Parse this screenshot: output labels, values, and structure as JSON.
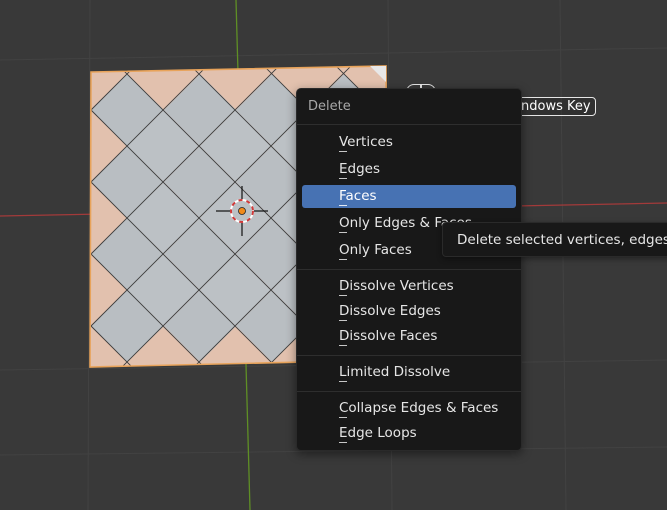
{
  "viewport": {
    "background": "#393939",
    "axis_x_color": "#b23a3a",
    "axis_y_color": "#6c9a2a",
    "selected_face_color": "#e8c4b2",
    "mesh_face_color": "#b9bec2",
    "selection_edge_color": "#e8a35a"
  },
  "key_overlay": {
    "label": "ndows Key"
  },
  "menu": {
    "title": "Delete",
    "items": [
      {
        "label": "Vertices",
        "active": false
      },
      {
        "label": "Edges",
        "active": false
      },
      {
        "label": "Faces",
        "active": true
      },
      {
        "label": "Only Edges & Faces",
        "active": false
      },
      {
        "label": "Only Faces",
        "active": false
      },
      {
        "label": "Dissolve Vertices",
        "active": false
      },
      {
        "label": "Dissolve Edges",
        "active": false
      },
      {
        "label": "Dissolve Faces",
        "active": false
      },
      {
        "label": "Limited Dissolve",
        "active": false
      },
      {
        "label": "Collapse Edges & Faces",
        "active": false
      },
      {
        "label": "Edge Loops",
        "active": false
      }
    ]
  },
  "tooltip": {
    "text": "Delete selected vertices, edges or faces"
  },
  "colors": {
    "menu_bg": "#181818",
    "highlight": "#4772b3",
    "text": "#e6e6e6"
  },
  "icons": {
    "cursor": "3d-cursor-icon",
    "mouse": "mouse-icon"
  }
}
